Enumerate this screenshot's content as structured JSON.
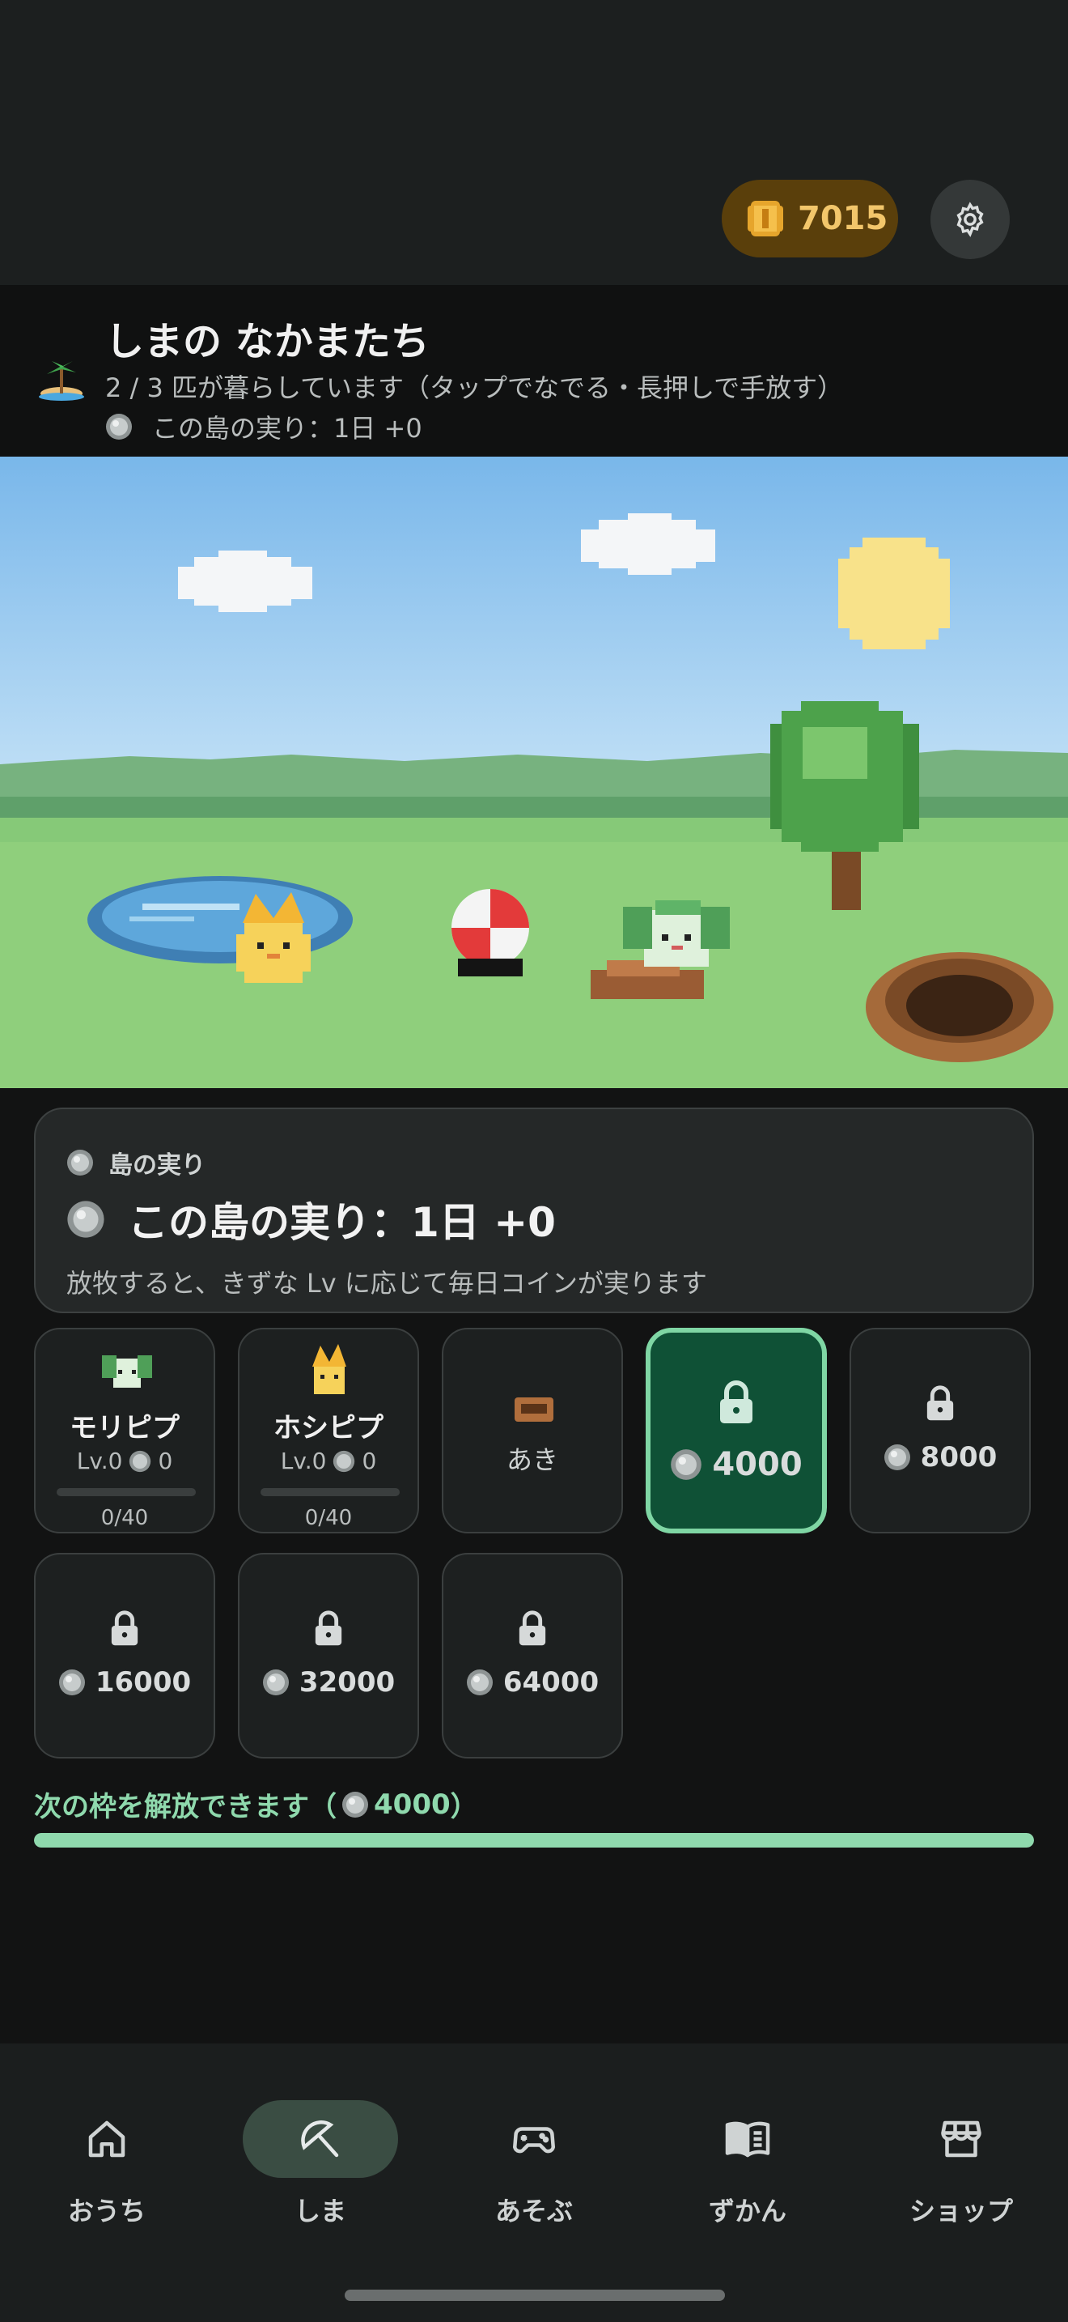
{
  "top_bar": {
    "coins": "7015",
    "icons": {
      "coin": "coin-icon",
      "settings": "gear-icon"
    }
  },
  "header": {
    "title": "しまの なかまたち",
    "subtitle": "2 / 3 匹が暮らしています（タップでなでる・長押しで手放す）",
    "fruit_line": "この島の実り：1日 +0"
  },
  "fruit_card": {
    "label": "島の実り",
    "title": "この島の実り：1日 +0",
    "description": "放牧すると、きずな Lv に応じて毎日コインが実ります"
  },
  "slots": [
    {
      "type": "pet",
      "name": "モリピプ",
      "level": "Lv.0",
      "coin_value": "0",
      "progress_text": "0/40",
      "progress": 0
    },
    {
      "type": "pet",
      "name": "ホシピプ",
      "level": "Lv.0",
      "coin_value": "0",
      "progress_text": "0/40",
      "progress": 0
    },
    {
      "type": "empty",
      "label": "あき"
    },
    {
      "type": "locked",
      "cost": "4000",
      "selected": true
    },
    {
      "type": "locked",
      "cost": "8000"
    },
    {
      "type": "locked",
      "cost": "16000"
    },
    {
      "type": "locked",
      "cost": "32000"
    },
    {
      "type": "locked",
      "cost": "64000"
    }
  ],
  "unlock": {
    "prefix": "次の枠を解放できます（",
    "cost": "4000",
    "suffix": "）",
    "progress": 1.0
  },
  "nav": {
    "items": [
      {
        "label": "おうち",
        "icon": "home-icon",
        "active": false
      },
      {
        "label": "しま",
        "icon": "island-icon",
        "active": true
      },
      {
        "label": "あそぶ",
        "icon": "gamepad-icon",
        "active": false
      },
      {
        "label": "ずかん",
        "icon": "book-icon",
        "active": false
      },
      {
        "label": "ショップ",
        "icon": "shop-icon",
        "active": false
      }
    ]
  },
  "colors": {
    "accent": "#8fd9ad",
    "coin": "#f2c66b",
    "selected_slot": "#0f5136"
  }
}
